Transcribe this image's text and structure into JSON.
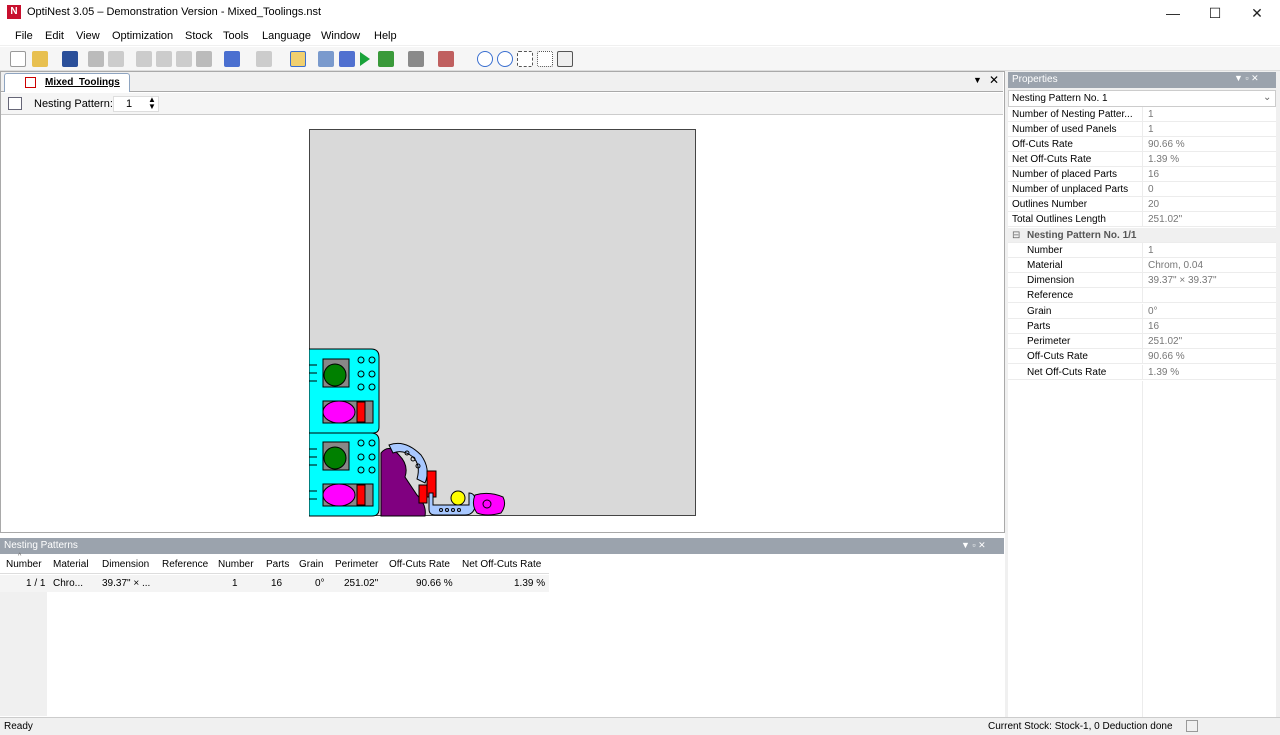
{
  "window": {
    "title": "OptiNest 3.05 – Demonstration Version - Mixed_Toolings.nst",
    "app_icon": "N",
    "minimize": "—",
    "maximize": "☐",
    "close": "✕"
  },
  "menu": [
    "File",
    "Edit",
    "View",
    "Optimization",
    "Stock",
    "Tools",
    "Language",
    "Window",
    "Help"
  ],
  "document": {
    "tab_label": "Mixed_Toolings",
    "nesting_pattern_label": "Nesting Pattern:",
    "nesting_pattern_value": "1"
  },
  "properties": {
    "title": "Properties",
    "selected": "Nesting Pattern No. 1",
    "rows": [
      {
        "name": "Number of Nesting Patter...",
        "value": "1"
      },
      {
        "name": "Number of used Panels",
        "value": "1"
      },
      {
        "name": "Off-Cuts Rate",
        "value": "90.66 %"
      },
      {
        "name": "Net Off-Cuts Rate",
        "value": "1.39 %"
      },
      {
        "name": "Number of placed Parts",
        "value": "16"
      },
      {
        "name": "Number of unplaced Parts",
        "value": "0"
      },
      {
        "name": "Outlines Number",
        "value": "20"
      },
      {
        "name": "Total Outlines Length",
        "value": "251.02\""
      }
    ],
    "group_label": "Nesting Pattern No. 1/1",
    "group_toggle": "⊟",
    "group_rows": [
      {
        "name": "Number",
        "value": "1"
      },
      {
        "name": "Material",
        "value": "Chrom, 0.04"
      },
      {
        "name": "Dimension",
        "value": "39.37\" × 39.37\""
      },
      {
        "name": "Reference",
        "value": ""
      },
      {
        "name": "Grain",
        "value": "0°"
      },
      {
        "name": "Parts",
        "value": "16"
      },
      {
        "name": "Perimeter",
        "value": "251.02\""
      },
      {
        "name": "Off-Cuts Rate",
        "value": "90.66 %"
      },
      {
        "name": "Net Off-Cuts Rate",
        "value": "1.39 %"
      }
    ]
  },
  "nesting_patterns": {
    "title": "Nesting Patterns",
    "columns": [
      "Number",
      "Material",
      "Dimension",
      "Reference",
      "Number",
      "Parts",
      "Grain",
      "Perimeter",
      "Off-Cuts Rate",
      "Net Off-Cuts Rate"
    ],
    "row": [
      "1 / 1",
      "Chro...",
      "39.37\" × ...",
      "",
      "1",
      "16",
      "0°",
      "251.02\"",
      "90.66 %",
      "1.39 %"
    ]
  },
  "status": {
    "left": "Ready",
    "right": "Current Stock: Stock-1, 0 Deduction done"
  },
  "colors": {
    "part_fill": "#00ffff",
    "part_green": "#008000",
    "part_magenta": "#ff00ff",
    "part_red": "#ff0000",
    "part_purple": "#800080",
    "part_lightblue": "#a8c8ff",
    "part_yellow": "#ffff00",
    "sheet": "#d9d9d9"
  }
}
